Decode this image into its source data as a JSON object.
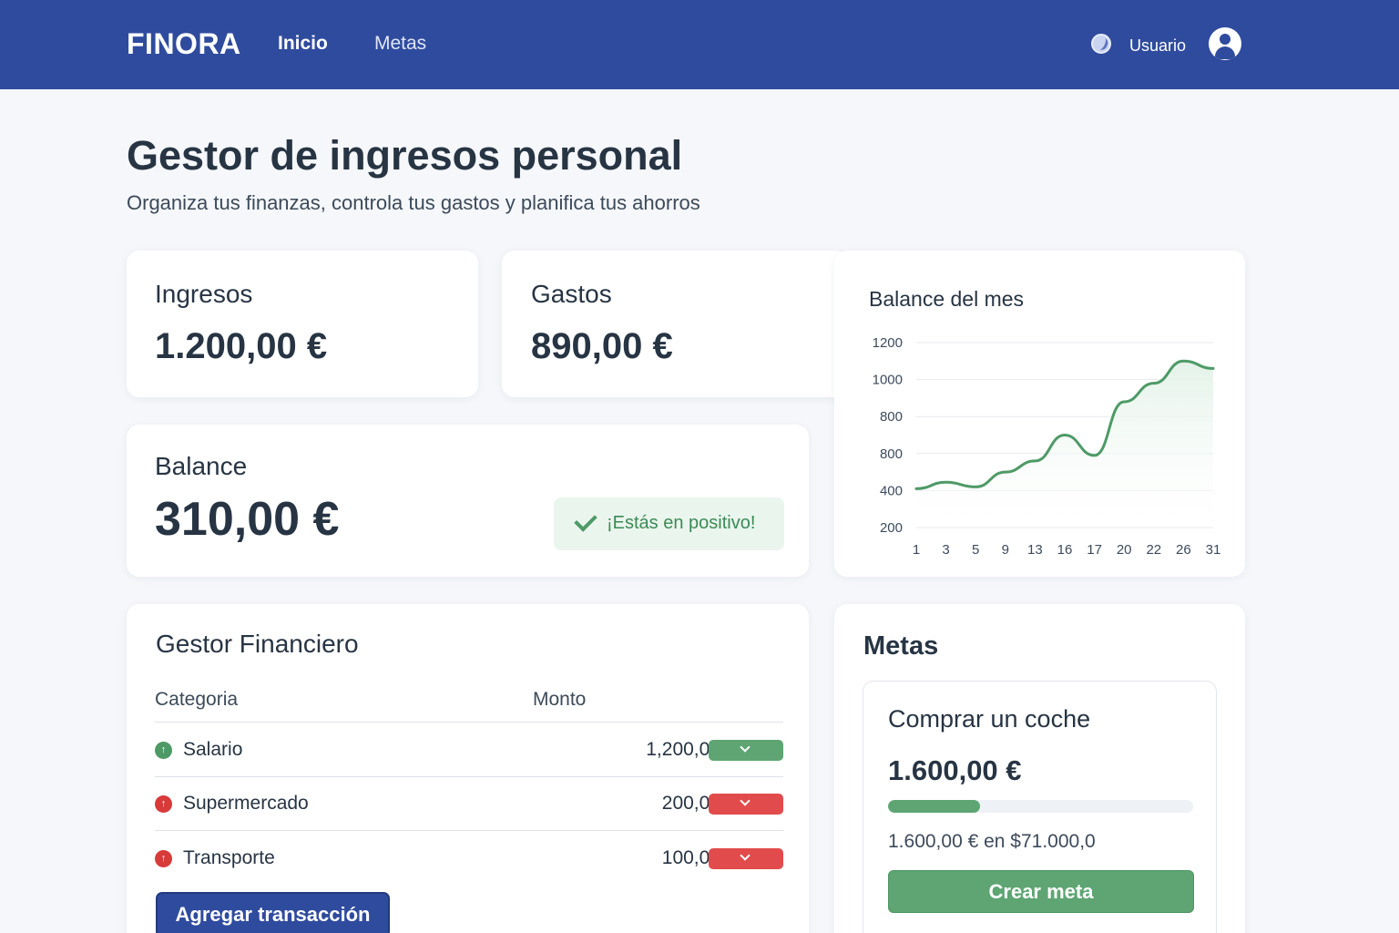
{
  "header": {
    "brand": "FINORA",
    "nav": [
      {
        "label": "Inicio",
        "active": true
      },
      {
        "label": "Metas",
        "active": false
      }
    ],
    "user_label": "Usuario",
    "icons": [
      "globe-icon",
      "user-avatar-icon"
    ]
  },
  "page": {
    "title": "Gestor de ingresos personal",
    "subtitle": "Organiza tus finanzas, controla tus gastos y planifica tus ahorros"
  },
  "summary": {
    "ingresos": {
      "label": "Ingresos",
      "value": "1.200,00 €"
    },
    "gastos": {
      "label": "Gastos",
      "value": "890,00 €"
    },
    "balance": {
      "label": "Balance",
      "value": "310,00 €",
      "status": "¡Estás en positivo!"
    }
  },
  "chart_data": {
    "type": "area",
    "title": "Balance del mes",
    "x": [
      "1",
      "3",
      "5",
      "9",
      "13",
      "16",
      "17",
      "20",
      "22",
      "26",
      "31"
    ],
    "y_ticks": [
      "200",
      "400",
      "800",
      "800",
      "1000",
      "1200"
    ],
    "series": [
      {
        "values": [
          410,
          445,
          420,
          500,
          560,
          700,
          590,
          880,
          980,
          1100,
          1060
        ]
      }
    ],
    "line_color": "#4e9a66",
    "fill_color": "#e3f2e8",
    "grid": true
  },
  "gestor": {
    "title": "Gestor Financiero",
    "columns": [
      "Categoria",
      "Monto"
    ],
    "rows": [
      {
        "category": "Salario",
        "amount": "1,200,00",
        "type": "income",
        "marker": "↑"
      },
      {
        "category": "Supermercado",
        "amount": "200,00",
        "type": "expense",
        "marker": "↑"
      },
      {
        "category": "Transporte",
        "amount": "100,00",
        "type": "expense",
        "marker": "↑"
      }
    ],
    "add_button": "Agregar transacción"
  },
  "metas": {
    "title": "Metas",
    "goal": {
      "name": "Comprar un coche",
      "amount": "1.600,00 €",
      "progress": 0.3,
      "detail": "1.600,00 € en $71.000,0"
    },
    "create_button": "Crear meta"
  },
  "colors": {
    "header_bg": "#2f4b9e",
    "income": "#4e9a66",
    "expense": "#d83a3a",
    "background": "#f5f7fa"
  }
}
